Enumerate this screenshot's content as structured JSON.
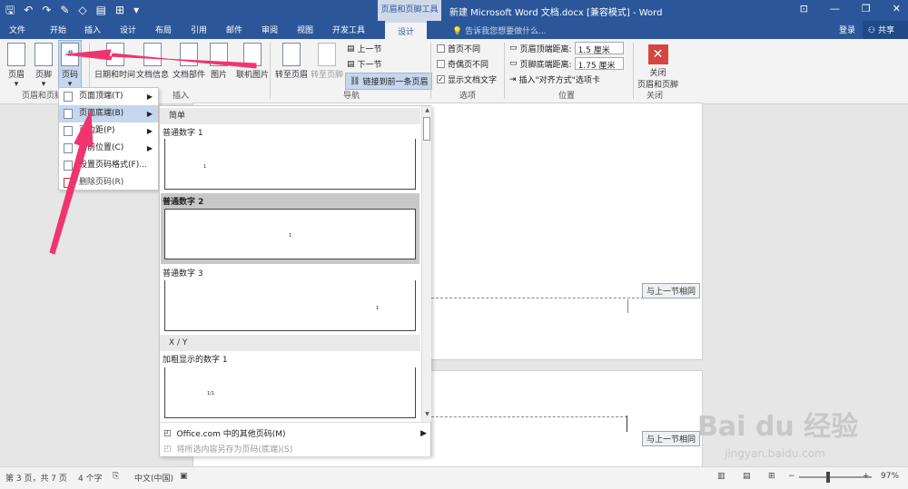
{
  "titlebar": {
    "context_tools": "页眉和页脚工具",
    "doc_title": "新建 Microsoft Word 文档.docx [兼容模式] - Word",
    "win_buttons": [
      "⊡",
      "—",
      "❐",
      "✕"
    ]
  },
  "tabs": [
    {
      "label": "文件"
    },
    {
      "label": "开始"
    },
    {
      "label": "插入"
    },
    {
      "label": "设计"
    },
    {
      "label": "布局"
    },
    {
      "label": "引用"
    },
    {
      "label": "邮件"
    },
    {
      "label": "审阅"
    },
    {
      "label": "视图"
    },
    {
      "label": "开发工具"
    },
    {
      "label": "设计"
    }
  ],
  "tell_me": "告诉我您想要做什么...",
  "login": "登录",
  "share": "共享",
  "ribbon": {
    "header": "页眉",
    "footer": "页脚",
    "page_number": "页码",
    "date_time": "日期和时间",
    "doc_info": "文档信息",
    "doc_parts": "文档部件",
    "picture": "图片",
    "online_picture": "联机图片",
    "goto_header": "转至页眉",
    "goto_footer": "转至页脚",
    "prev_section": "上一节",
    "next_section": "下一节",
    "link_prev": "链接到前一条页眉",
    "diff_first": "首页不同",
    "diff_odd_even": "奇偶页不同",
    "show_doc_text": "显示文档文字",
    "header_top": "页眉顶端距离:",
    "footer_bottom": "页脚底端距离:",
    "header_val": "1.5 厘米",
    "footer_val": "1.75 厘米",
    "insert_align_tab": "插入\"对齐方式\"选项卡",
    "close_label_1": "关闭",
    "close_label_2": "页眉和页脚",
    "groups": {
      "header_footer": "页眉和页脚",
      "insert": "插入",
      "navigation": "导航",
      "options": "选项",
      "position": "位置",
      "close": "关闭"
    }
  },
  "menu": {
    "items": [
      {
        "label": "页面顶端(T)"
      },
      {
        "label": "页面底端(B)"
      },
      {
        "label": "页边距(P)"
      },
      {
        "label": "当前位置(C)"
      },
      {
        "label": "设置页码格式(F)..."
      },
      {
        "label": "删除页码(R)"
      }
    ]
  },
  "gallery": {
    "section_simple": "简单",
    "section_xy": "X / Y",
    "items": [
      {
        "label": "普通数字 1",
        "num": "1"
      },
      {
        "label": "普通数字 2",
        "num": "1"
      },
      {
        "label": "普通数字 3",
        "num": "1"
      },
      {
        "label": "加粗显示的数字 1",
        "num": "1/1"
      }
    ],
    "more": "Office.com 中的其他页码(M)",
    "save": "将所选内容另存为页码(底端)(S)"
  },
  "doc": {
    "same_prev_1": "与上一节相同",
    "same_prev_2": "与上一节相同"
  },
  "statusbar": {
    "page": "第 3 页，共 7 页",
    "words": "4 个字",
    "lang": "中文(中国)",
    "zoom": "97%"
  },
  "watermark": {
    "text": "Bai du 经验",
    "url": "jingyan.baidu.com"
  }
}
